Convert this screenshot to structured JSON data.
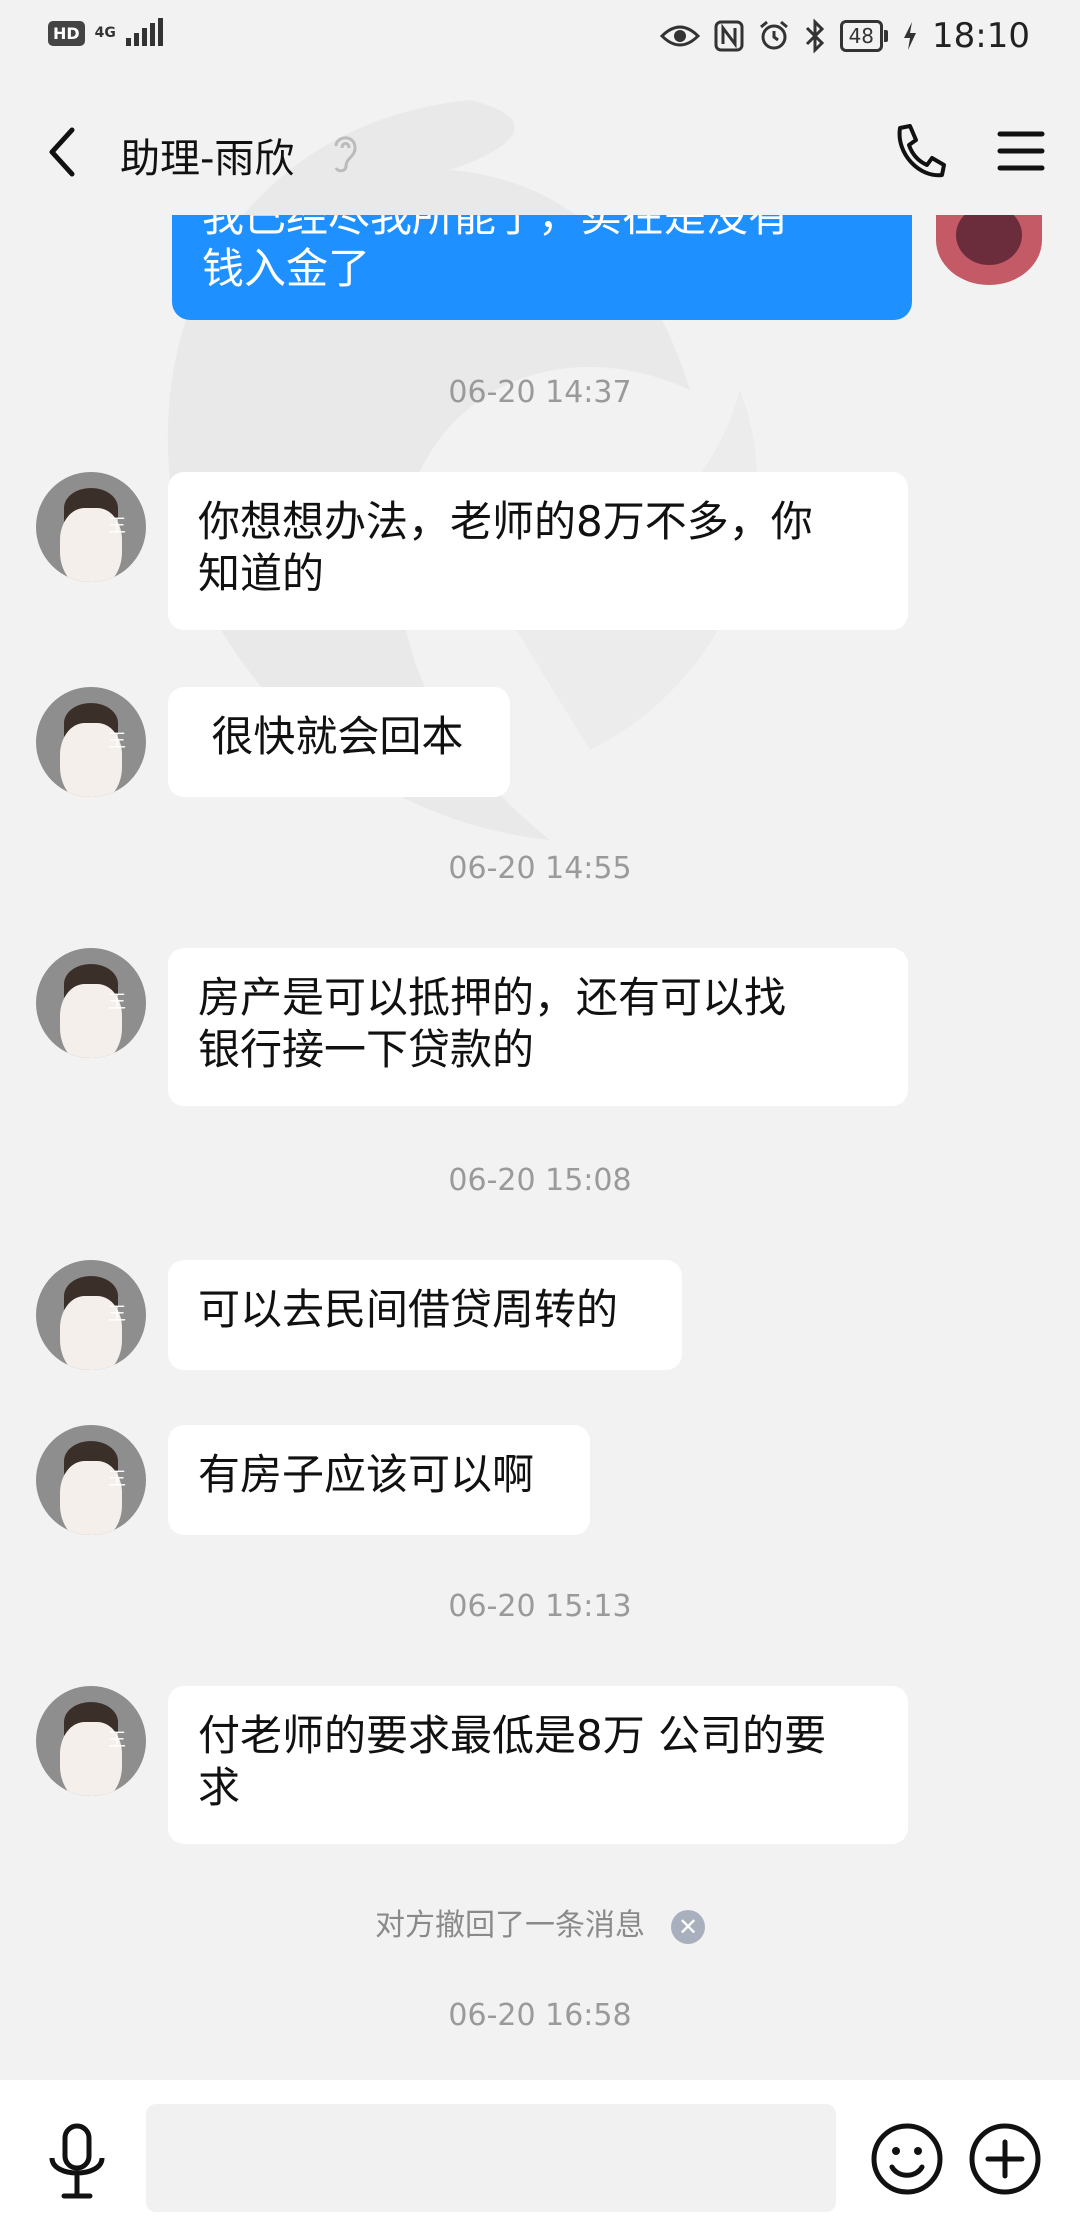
{
  "status_bar": {
    "hd": "HD",
    "network": "4G",
    "battery": "48",
    "time": "18:10"
  },
  "header": {
    "title": "助理-雨欣"
  },
  "messages": {
    "top_partial": "我已经尽我所能了，实在是没有\n钱入金了",
    "ts1": "06-20 14:37",
    "m1": "你想想办法，老师的8万不多，你\n知道的",
    "m2": " 很快就会回本",
    "ts2": "06-20 14:55",
    "m3": "房产是可以抵押的，还有可以找\n银行接一下贷款的",
    "ts3": "06-20 15:08",
    "m4": "可以去民间借贷周转的",
    "m5": "有房子应该可以啊",
    "ts4": "06-20 15:13",
    "m6": "付老师的要求最低是8万 公司的要\n求",
    "recall": "对方撤回了一条消息",
    "ts5": "06-20 16:58"
  },
  "avatar_text": "王",
  "colors": {
    "outgoing_bubble": "#1e90ff",
    "incoming_bubble": "#ffffff",
    "background": "#f2f2f2"
  }
}
